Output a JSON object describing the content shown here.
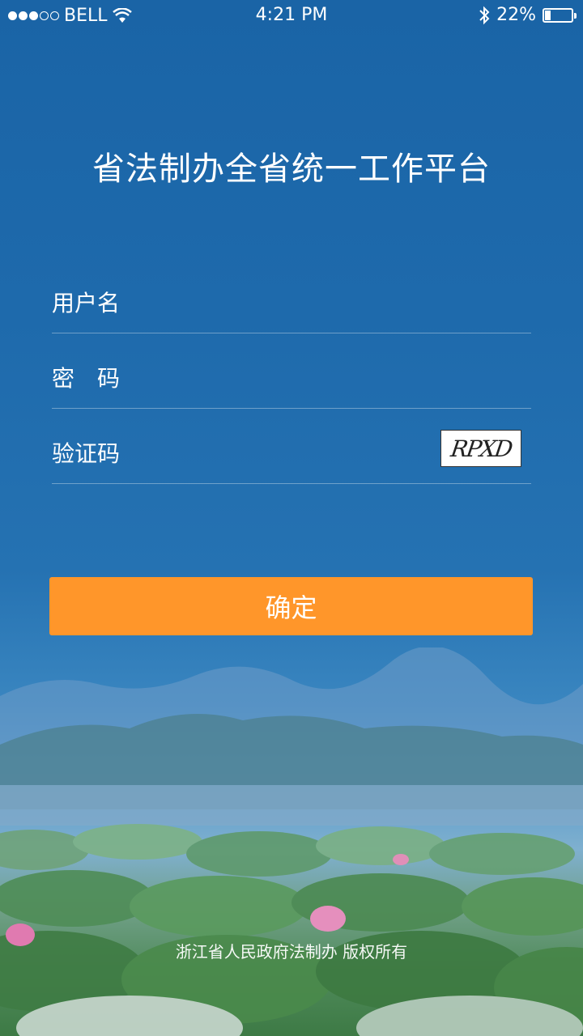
{
  "status_bar": {
    "carrier": "BELL",
    "time": "4:21 PM",
    "battery_text": "22%",
    "battery_level": 0.22
  },
  "app": {
    "title": "省法制办全省统一工作平台"
  },
  "form": {
    "username_label": "用户名",
    "password_label": "密　码",
    "captcha_label": "验证码",
    "captcha_text": "RPXD",
    "username_value": "",
    "password_value": "",
    "captcha_value": ""
  },
  "actions": {
    "confirm_label": "确定"
  },
  "footer": {
    "copyright": "浙江省人民政府法制办  版权所有"
  },
  "colors": {
    "background": "#1e6aac",
    "accent": "#ff962a"
  }
}
